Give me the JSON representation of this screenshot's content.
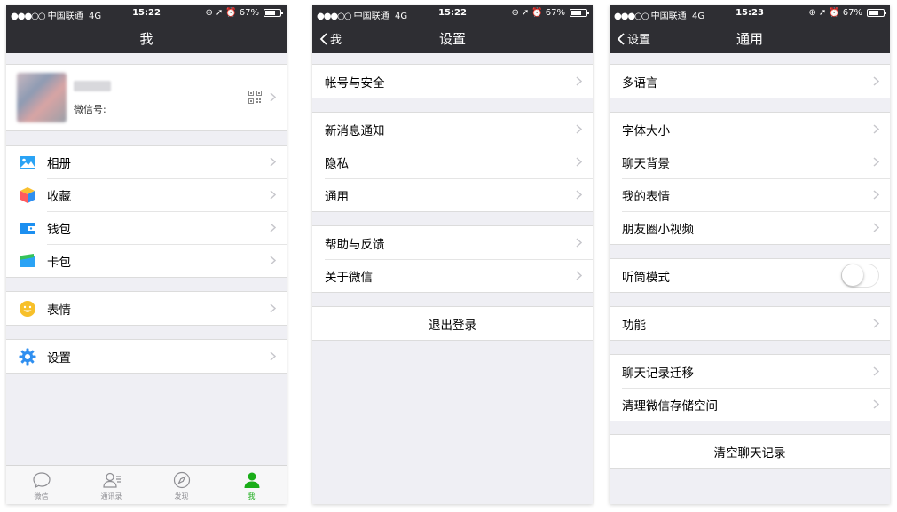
{
  "status": [
    {
      "carrier": "中国联通",
      "network": "4G",
      "time": "15:22",
      "battery": "67%",
      "battery_fill": 0.67
    },
    {
      "carrier": "中国联通",
      "network": "4G",
      "time": "15:22",
      "battery": "67%",
      "battery_fill": 0.67
    },
    {
      "carrier": "中国联通",
      "network": "4G",
      "time": "15:23",
      "battery": "67%",
      "battery_fill": 0.67
    }
  ],
  "me": {
    "title": "我",
    "profile": {
      "wechat_id_label": "微信号:"
    },
    "items": [
      {
        "label": "相册",
        "icon": "photo-album-icon"
      },
      {
        "label": "收藏",
        "icon": "favorites-cube-icon"
      },
      {
        "label": "钱包",
        "icon": "wallet-icon"
      },
      {
        "label": "卡包",
        "icon": "card-pack-icon"
      },
      {
        "label": "表情",
        "icon": "emoji-smiley-icon"
      },
      {
        "label": "设置",
        "icon": "gear-icon"
      }
    ],
    "tabs": [
      {
        "label": "微信",
        "icon": "chat-bubble-icon"
      },
      {
        "label": "通讯录",
        "icon": "contacts-icon"
      },
      {
        "label": "发现",
        "icon": "compass-icon"
      },
      {
        "label": "我",
        "icon": "person-icon"
      }
    ],
    "accent": "#1aad19"
  },
  "settings": {
    "title": "设置",
    "back": "我",
    "items": [
      "帐号与安全",
      "新消息通知",
      "隐私",
      "通用",
      "帮助与反馈",
      "关于微信"
    ],
    "logout": "退出登录"
  },
  "general": {
    "title": "通用",
    "back": "设置",
    "items": [
      "多语言",
      "字体大小",
      "聊天背景",
      "我的表情",
      "朋友圈小视频",
      "听筒模式",
      "功能",
      "聊天记录迁移",
      "清理微信存储空间"
    ],
    "earpiece_mode_on": false,
    "clear_history": "清空聊天记录"
  }
}
